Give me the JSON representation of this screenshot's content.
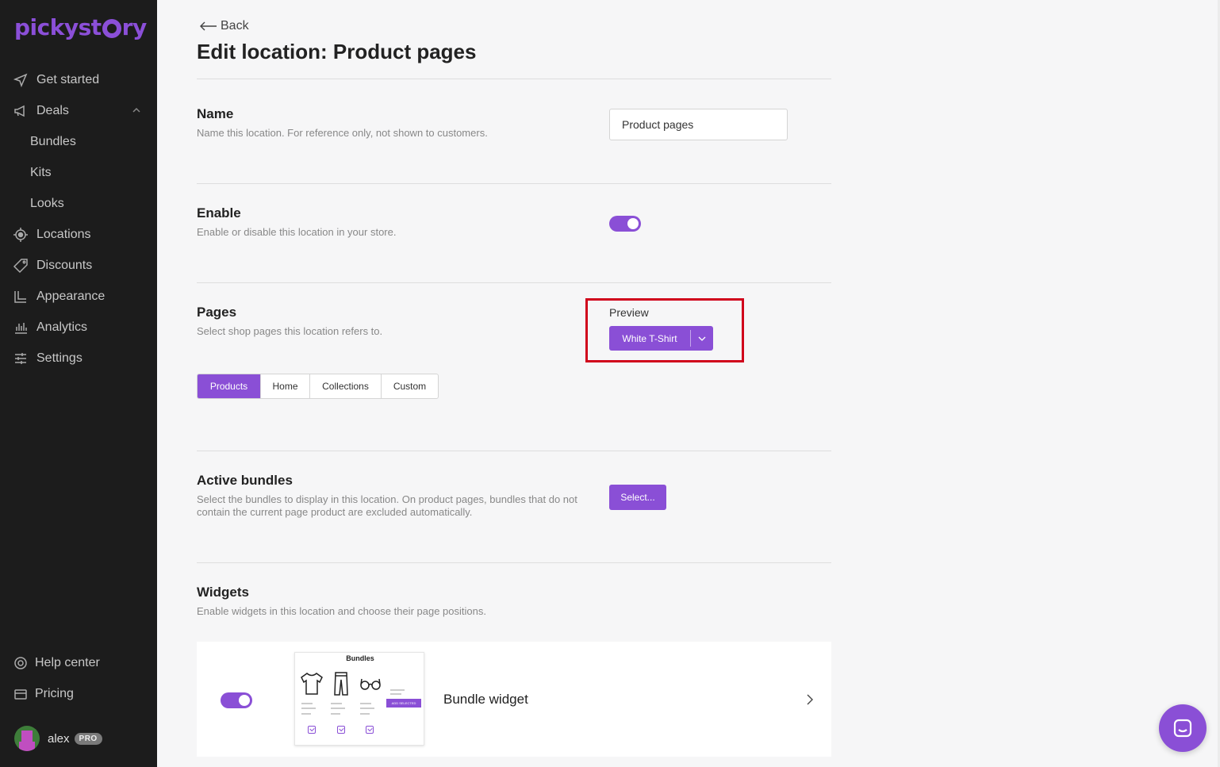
{
  "app": {
    "logo_text": "pickystory"
  },
  "sidebar": {
    "items": [
      {
        "label": "Get started",
        "icon": "send-icon"
      },
      {
        "label": "Deals",
        "icon": "megaphone-icon"
      },
      {
        "label": "Bundles"
      },
      {
        "label": "Kits"
      },
      {
        "label": "Looks"
      },
      {
        "label": "Locations",
        "icon": "target-icon"
      },
      {
        "label": "Discounts",
        "icon": "tag-icon"
      },
      {
        "label": "Appearance",
        "icon": "brush-icon"
      },
      {
        "label": "Analytics",
        "icon": "bar-chart-icon"
      },
      {
        "label": "Settings",
        "icon": "sliders-icon"
      }
    ],
    "bottom": [
      {
        "label": "Help center",
        "icon": "help-icon"
      },
      {
        "label": "Pricing",
        "icon": "credit-card-icon"
      }
    ],
    "user": {
      "name": "alex",
      "badge": "PRO"
    }
  },
  "page": {
    "back_label": "Back",
    "title": "Edit location: Product pages"
  },
  "sections": {
    "name": {
      "title": "Name",
      "desc": "Name this location. For reference only, not shown to customers.",
      "value": "Product pages"
    },
    "enable": {
      "title": "Enable",
      "desc": "Enable or disable this location in your store.",
      "enabled": true
    },
    "pages": {
      "title": "Pages",
      "desc": "Select shop pages this location refers to.",
      "preview_label": "Preview",
      "preview_value": "White T-Shirt",
      "options": [
        "Products",
        "Home",
        "Collections",
        "Custom"
      ],
      "selected": "Products"
    },
    "active_bundles": {
      "title": "Active bundles",
      "desc": "Select the bundles to display in this location. On product pages, bundles that do not contain the current page product are excluded automatically.",
      "button": "Select..."
    },
    "widgets": {
      "title": "Widgets",
      "desc": "Enable widgets in this location and choose their page positions.",
      "items": [
        {
          "name": "Bundle widget",
          "enabled": true,
          "thumb_title": "Bundles",
          "thumb_button": "ADD SELECTED"
        }
      ]
    }
  },
  "colors": {
    "accent": "#8a4fd6",
    "sidebar_bg": "#1c1c1c",
    "highlight": "#d0021b"
  }
}
